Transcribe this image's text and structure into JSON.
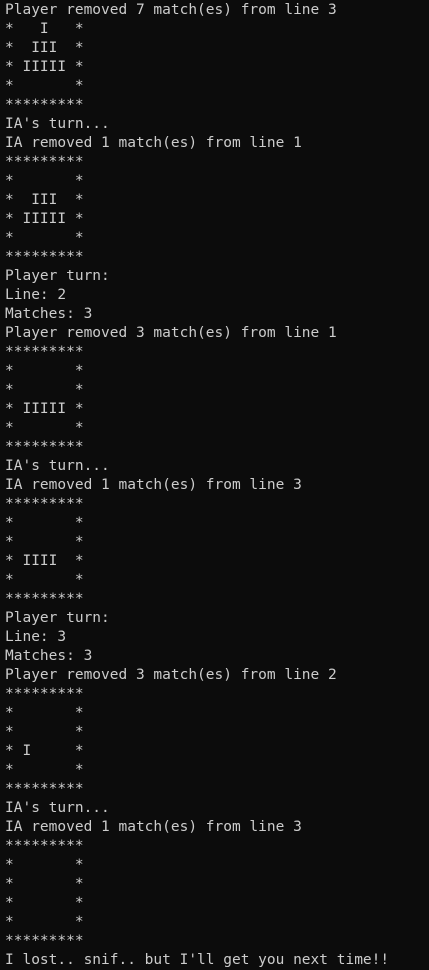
{
  "terminal": {
    "background": "#0c0c0c",
    "foreground": "#cccccc",
    "lines": [
      "Player removed 7 match(es) from line 3",
      "*   I   *",
      "*  III  *",
      "* IIIII *",
      "*       *",
      "*********",
      "IA's turn...",
      "IA removed 1 match(es) from line 1",
      "*********",
      "*       *",
      "*  III  *",
      "* IIIII *",
      "*       *",
      "*********",
      "Player turn:",
      "Line: 2",
      "Matches: 3",
      "Player removed 3 match(es) from line 1",
      "*********",
      "*       *",
      "*       *",
      "* IIIII *",
      "*       *",
      "*********",
      "IA's turn...",
      "IA removed 1 match(es) from line 3",
      "*********",
      "*       *",
      "*       *",
      "* IIII  *",
      "*       *",
      "*********",
      "Player turn:",
      "Line: 3",
      "Matches: 3",
      "Player removed 3 match(es) from line 2",
      "*********",
      "*       *",
      "*       *",
      "* I     *",
      "*       *",
      "*********",
      "IA's turn...",
      "IA removed 1 match(es) from line 3",
      "*********",
      "*       *",
      "*       *",
      "*       *",
      "*       *",
      "*********",
      "I lost.. snif.. but I'll get you next time!!"
    ]
  }
}
